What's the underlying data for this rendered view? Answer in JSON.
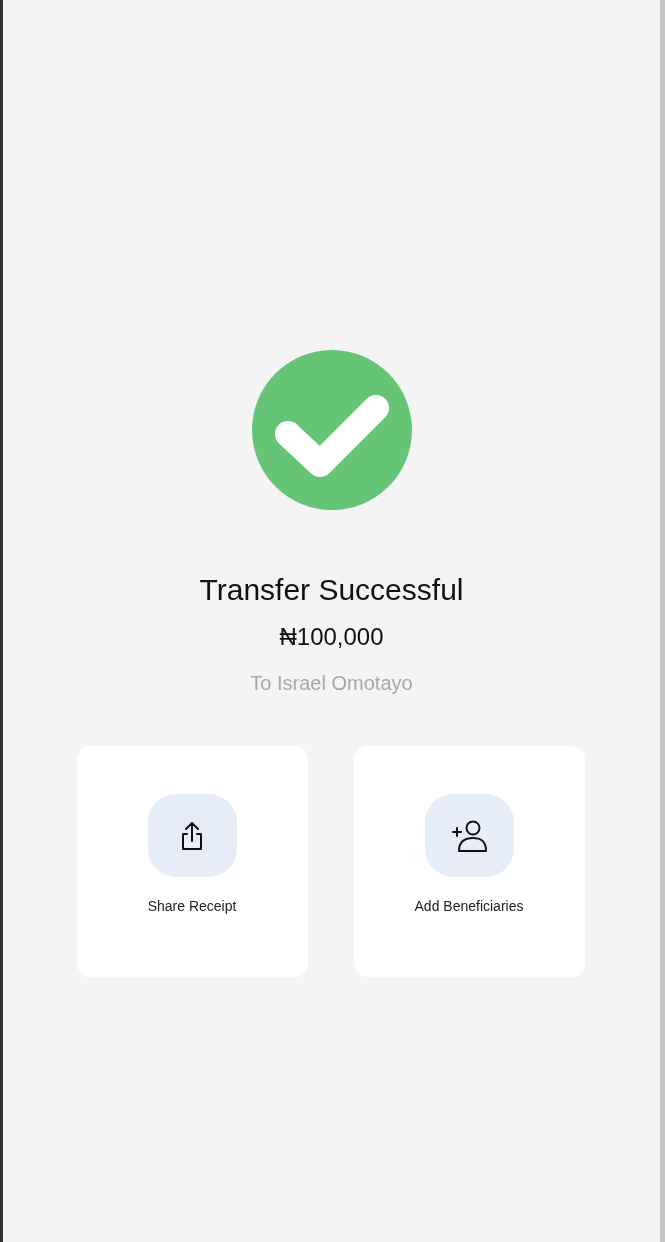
{
  "status": {
    "title": "Transfer Successful",
    "amount": "₦100,000",
    "recipient": "To Israel Omotayo"
  },
  "actions": [
    {
      "kind": "share",
      "label": "Share Receipt"
    },
    {
      "kind": "add-person",
      "label": "Add Beneficiaries"
    }
  ]
}
